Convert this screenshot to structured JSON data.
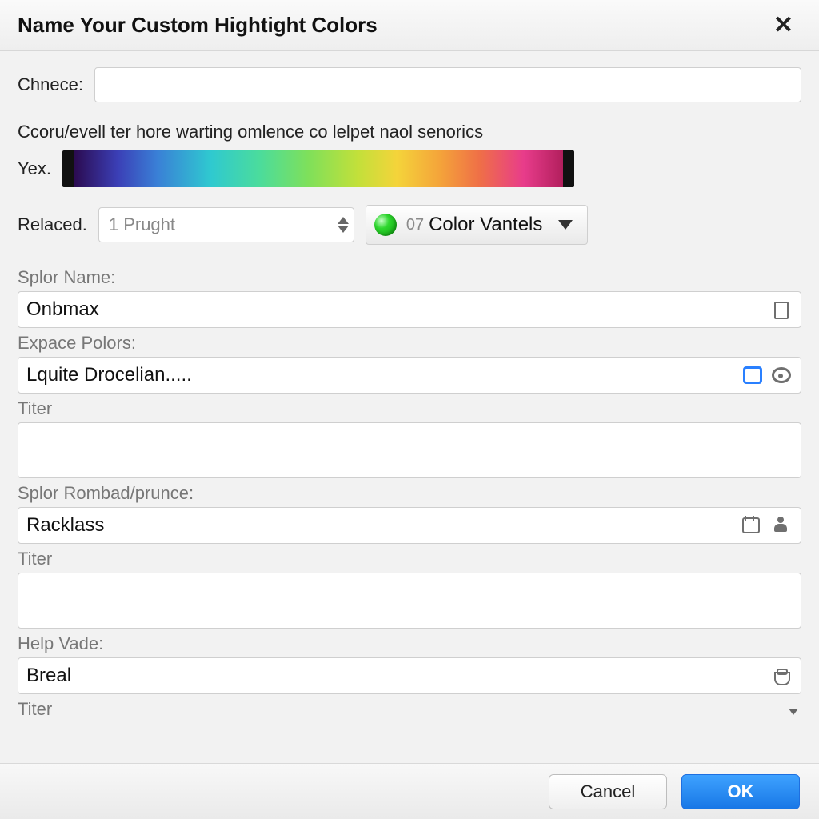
{
  "dialog": {
    "title": "Name Your Custom Hightight Colors"
  },
  "fields": {
    "chnece": {
      "label": "Chnece:",
      "value": ""
    },
    "subtext": "Ccoru/evell ter hore warting omlence co lelpet naol senorics",
    "yex": {
      "label": "Yex."
    },
    "relaced": {
      "label": "Relaced.",
      "spinner_value": "1 Prught",
      "color_combo": {
        "code": "07",
        "label": "Color Vantels"
      }
    },
    "splor_name": {
      "label": "Splor Name:",
      "value": "Onbmax"
    },
    "expace_polors": {
      "label": "Expace Polors:",
      "value": "Lquite Drocelian....."
    },
    "titer1": {
      "label": "Titer",
      "value": ""
    },
    "splor_rombad": {
      "label": "Splor Rombad/prunce:",
      "value": "Racklass"
    },
    "titer2": {
      "label": "Titer",
      "value": ""
    },
    "help_vade": {
      "label": "Help Vade:",
      "value": "Breal"
    },
    "titer3": {
      "label": "Titer"
    }
  },
  "footer": {
    "cancel": "Cancel",
    "ok": "OK"
  }
}
